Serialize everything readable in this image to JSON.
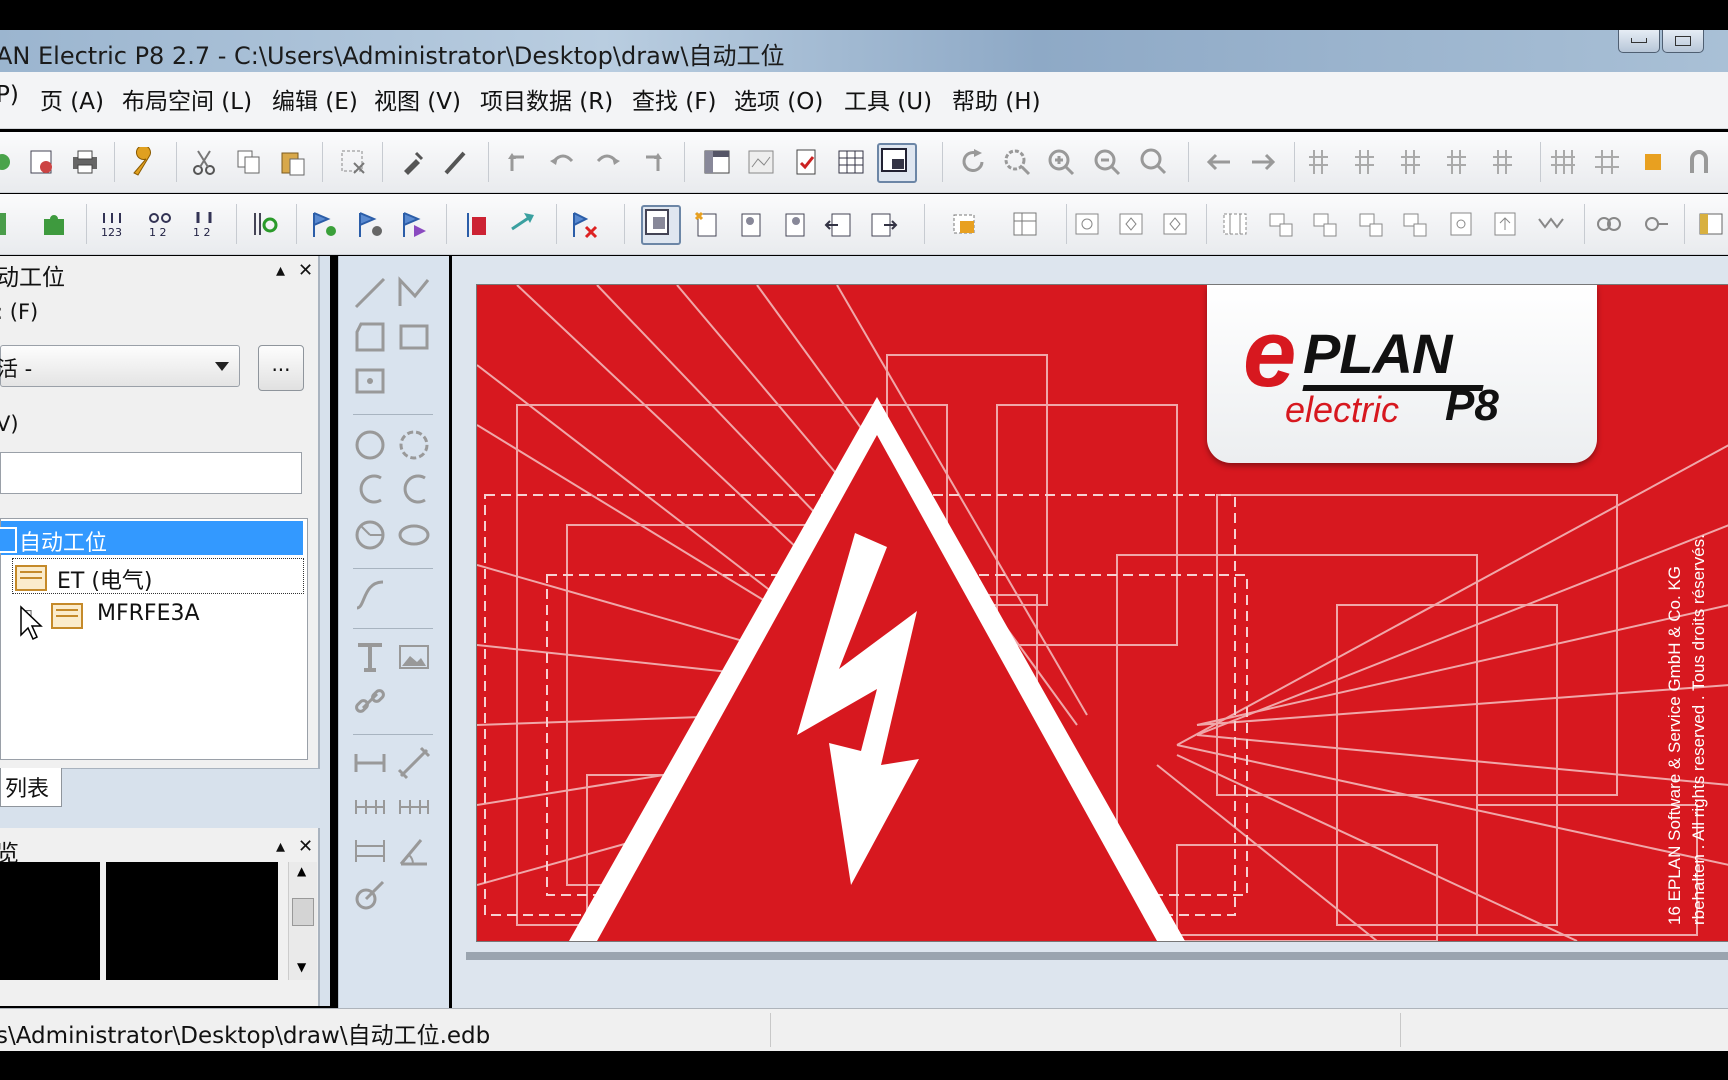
{
  "window": {
    "title": "AN Electric P8 2.7 - C:\\Users\\Administrator\\Desktop\\draw\\自动工位"
  },
  "menu": [
    {
      "label": "P)"
    },
    {
      "label": "页 (A)"
    },
    {
      "label": "布局空间 (L)"
    },
    {
      "label": "编辑 (E)"
    },
    {
      "label": "视图 (V)"
    },
    {
      "label": "项目数据 (R)"
    },
    {
      "label": "查找 (F)"
    },
    {
      "label": "选项 (O)"
    },
    {
      "label": "工具 (U)"
    },
    {
      "label": "帮助 (H)"
    }
  ],
  "nav_panel": {
    "title": "动工位",
    "filter_label": ": (F)",
    "filter_value": "活 -",
    "browse_button": "...",
    "value_label": "V)",
    "tree": [
      {
        "label": "自动工位",
        "icon": "project-icon",
        "selected": true
      },
      {
        "label": "ET (电气)",
        "icon": "structure-icon",
        "focused": true
      },
      {
        "label": "MFRFE3A",
        "icon": "structure-icon"
      }
    ],
    "tab": "列表"
  },
  "preview_panel": {
    "title": "览"
  },
  "splash": {
    "logo_e": "e",
    "logo_plan": "PLAN",
    "logo_electric": "electric",
    "logo_p8": "P8",
    "copyright_line1": "16 EPLAN Software & Service GmbH & Co. KG",
    "copyright_line2": "rbehalten . All rights reserved . Tous droits réservés."
  },
  "status": {
    "path": "s\\Administrator\\Desktop\\draw\\自动工位.edb"
  },
  "colors": {
    "splash_red": "#d7181f",
    "selection_blue": "#3399ff",
    "cursor_ring": "#62d15a"
  }
}
